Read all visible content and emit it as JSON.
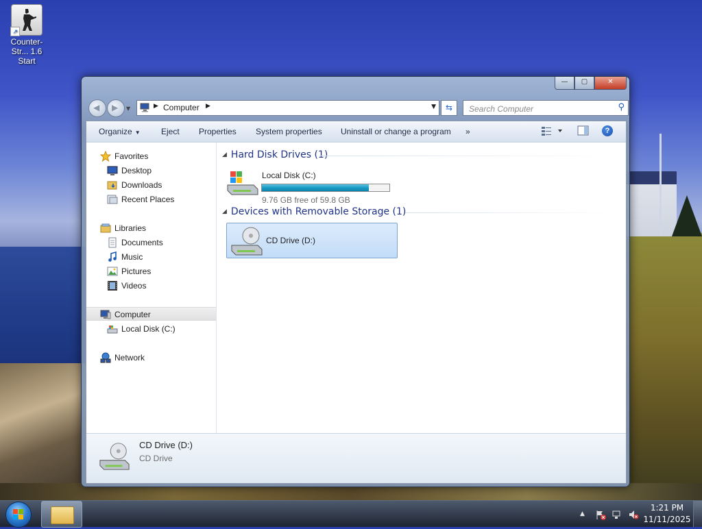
{
  "desktop": {
    "icons": [
      {
        "label": "Counter-Str... 1.6 Start",
        "icon": "counter-strike-icon"
      }
    ]
  },
  "window": {
    "caption_buttons": {
      "minimize": "—",
      "maximize": "▢",
      "close": "✕"
    },
    "address": {
      "location": "Computer"
    },
    "search": {
      "placeholder": "Search Computer"
    },
    "toolbar": {
      "organize": "Organize",
      "eject": "Eject",
      "properties": "Properties",
      "system_properties": "System properties",
      "uninstall": "Uninstall or change a program",
      "more": "»"
    },
    "nav_pane": {
      "favorites": "Favorites",
      "desktop": "Desktop",
      "downloads": "Downloads",
      "recent_places": "Recent Places",
      "libraries": "Libraries",
      "documents": "Documents",
      "music": "Music",
      "pictures": "Pictures",
      "videos": "Videos",
      "computer": "Computer",
      "local_disk": "Local Disk (C:)",
      "network": "Network"
    },
    "groups": {
      "hard_disk": {
        "title": "Hard Disk Drives (1)",
        "drive_name": "Local Disk (C:)",
        "free_text": "9.76 GB free of 59.8 GB",
        "used_fraction": 0.837
      },
      "removable": {
        "title": "Devices with Removable Storage (1)",
        "drive_name": "CD Drive (D:)"
      }
    },
    "details": {
      "name": "CD Drive (D:)",
      "type": "CD Drive"
    }
  },
  "taskbar": {
    "clock_time": "1:21 PM",
    "clock_date": "11/11/2025",
    "tray_icons": [
      "show-hidden-icons-arrow",
      "action-center-flag-icon",
      "network-icon",
      "volume-muted-icon"
    ]
  },
  "colors": {
    "group_header": "#1e3287",
    "selection": "#c2dcf7",
    "disk_bar": "#1a9cc4"
  }
}
